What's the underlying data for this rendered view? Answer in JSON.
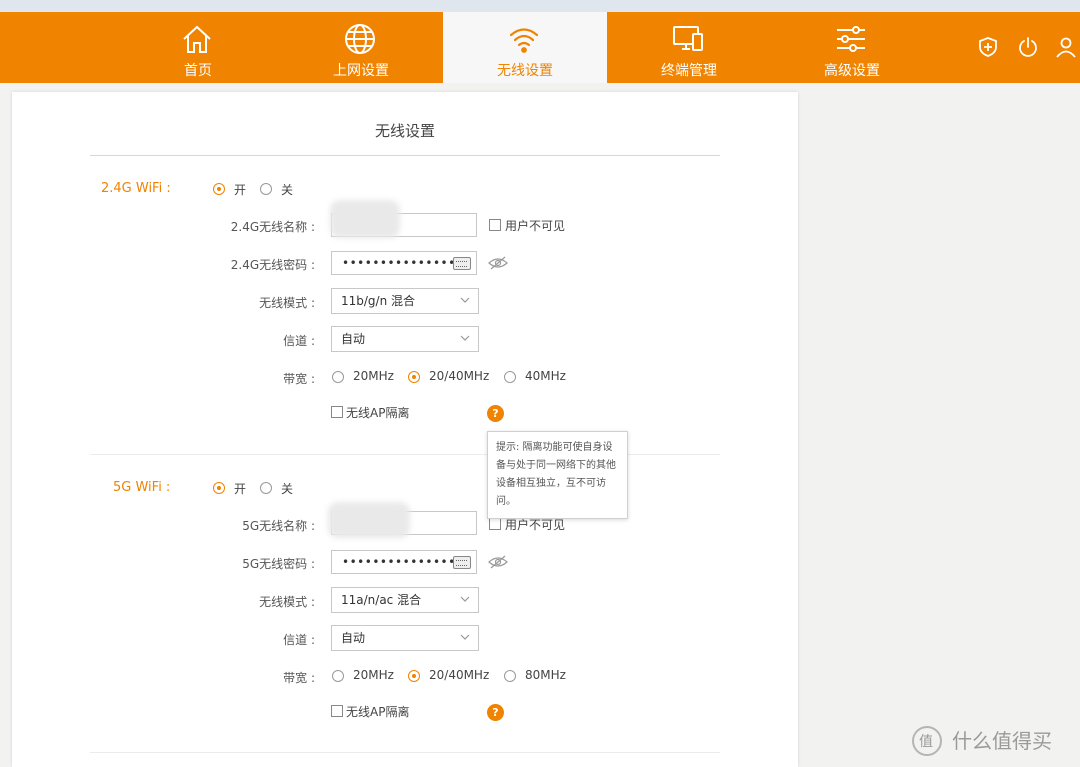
{
  "nav": {
    "items": [
      {
        "label": "首页",
        "icon": "home-icon"
      },
      {
        "label": "上网设置",
        "icon": "globe-icon"
      },
      {
        "label": "无线设置",
        "icon": "wifi-icon",
        "active": true
      },
      {
        "label": "终端管理",
        "icon": "devices-icon"
      },
      {
        "label": "高级设置",
        "icon": "sliders-icon"
      }
    ],
    "tools": [
      "shield-plus-icon",
      "power-icon",
      "user-icon"
    ],
    "accent": "#f08300"
  },
  "panel": {
    "title": "无线设置"
  },
  "wifi24": {
    "label": "2.4G WiFi :",
    "on_label": "开",
    "off_label": "关",
    "enabled": true,
    "ssid_label": "2.4G无线名称 :",
    "ssid_value": "",
    "hidden_label": "用户不可见",
    "pw_label": "2.4G无线密码 :",
    "pw_value": "•••••••••••••••",
    "mode_label": "无线模式 :",
    "mode_value": "11b/g/n 混合",
    "channel_label": "信道 :",
    "channel_value": "自动",
    "bw_label": "带宽 :",
    "bw_options": [
      "20MHz",
      "20/40MHz",
      "40MHz"
    ],
    "bw_selected": "20/40MHz",
    "isolation_label": "无线AP隔离",
    "help_symbol": "?"
  },
  "tooltip": {
    "text": "提示: 隔离功能可使自身设备与处于同一网络下的其他设备相互独立，互不可访问。"
  },
  "wifi5": {
    "label": "5G WiFi :",
    "on_label": "开",
    "off_label": "关",
    "enabled": true,
    "ssid_label": "5G无线名称 :",
    "ssid_value": "",
    "hidden_label": "用户不可见",
    "pw_label": "5G无线密码 :",
    "pw_value": "•••••••••••••••",
    "mode_label": "无线模式 :",
    "mode_value": "11a/n/ac 混合",
    "channel_label": "信道 :",
    "channel_value": "自动",
    "bw_label": "带宽 :",
    "bw_options": [
      "20MHz",
      "20/40MHz",
      "80MHz"
    ],
    "bw_selected": "20/40MHz",
    "isolation_label": "无线AP隔离",
    "help_symbol": "?"
  },
  "watermark": {
    "text": "什么值得买"
  }
}
